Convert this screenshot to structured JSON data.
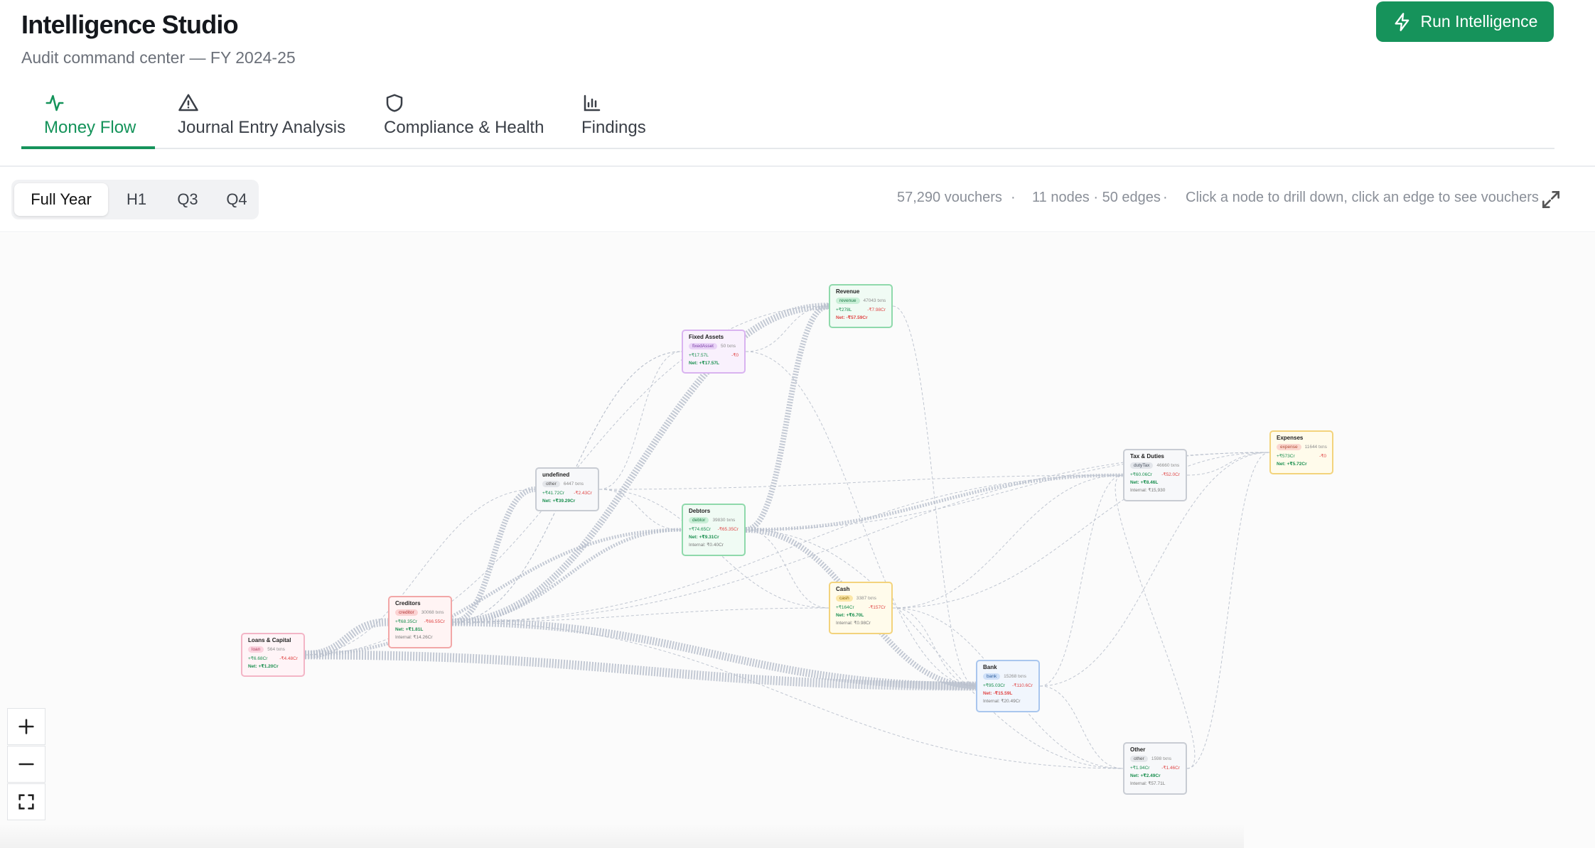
{
  "app": {
    "title": "Intelligence Studio",
    "subtitle": "Audit command center — FY 2024-25",
    "run_button": "Run Intelligence"
  },
  "tabs": [
    {
      "label": "Money Flow",
      "icon": "activity-icon",
      "active": true
    },
    {
      "label": "Journal Entry Analysis",
      "icon": "warning-triangle-icon",
      "active": false
    },
    {
      "label": "Compliance & Health",
      "icon": "shield-icon",
      "active": false
    },
    {
      "label": "Findings",
      "icon": "bar-chart-icon",
      "active": false
    }
  ],
  "periods": [
    {
      "label": "Full Year",
      "active": true
    },
    {
      "label": "H1",
      "active": false
    },
    {
      "label": "Q3",
      "active": false
    },
    {
      "label": "Q4",
      "active": false
    }
  ],
  "stats": {
    "vouchers": "57,290 vouchers",
    "sep1": "·",
    "graph": "11 nodes · 50 edges",
    "sep2": "·",
    "hint": "Click a node to drill down, click an edge to see vouchers"
  },
  "nodes": [
    {
      "id": "revenue",
      "name": "Revenue",
      "type": "revenue",
      "txns": "47043 txns",
      "inflow": "+₹278L",
      "outflow": "-₹7.98Cr",
      "net": "Net: -₹57.59Cr",
      "internal": ""
    },
    {
      "id": "fixed_assets",
      "name": "Fixed Assets",
      "type": "fixedAsset",
      "txns": "50 txns",
      "inflow": "+₹17.57L",
      "outflow": "-₹0",
      "net": "Net: +₹17.57L",
      "internal": ""
    },
    {
      "id": "undefined",
      "name": "undefined",
      "type": "other",
      "txns": "6447 txns",
      "inflow": "+₹41.72Cr",
      "outflow": "-₹2.43Cr",
      "net": "Net: +₹39.29Cr",
      "internal": ""
    },
    {
      "id": "debtors",
      "name": "Debtors",
      "type": "debtor",
      "txns": "39830 txns",
      "inflow": "+₹74.65Cr",
      "outflow": "-₹65.35Cr",
      "net": "Net: +₹9.31Cr",
      "internal": "Internal: ₹0.40Cr"
    },
    {
      "id": "cash",
      "name": "Cash",
      "type": "cash",
      "txns": "3387 txns",
      "inflow": "+₹164Cr",
      "outflow": "-₹157Cr",
      "net": "Net: +₹6.70L",
      "internal": "Internal: ₹0.98Cr"
    },
    {
      "id": "creditors",
      "name": "Creditors",
      "type": "creditor",
      "txns": "30068 txns",
      "inflow": "+₹68.35Cr",
      "outflow": "-₹66.55Cr",
      "net": "Net: +₹1.81L",
      "internal": "Internal: ₹14.26Cr"
    },
    {
      "id": "loans",
      "name": "Loans & Capital",
      "type": "loan",
      "txns": "564 txns",
      "inflow": "+₹6.68Cr",
      "outflow": "-₹4.48Cr",
      "net": "Net: +₹1.20Cr",
      "internal": ""
    },
    {
      "id": "bank",
      "name": "Bank",
      "type": "bank",
      "txns": "15268 txns",
      "inflow": "+₹95.03Cr",
      "outflow": "-₹110.6Cr",
      "net": "Net: -₹15.59L",
      "internal": "Internal: ₹20.49Cr"
    },
    {
      "id": "tax",
      "name": "Tax & Duties",
      "type": "dutyTax",
      "txns": "46660 txns",
      "inflow": "+₹60.06Cr",
      "outflow": "-₹52.0Cr",
      "net": "Net: +₹8.46L",
      "internal": "Internal: ₹15,930"
    },
    {
      "id": "expenses",
      "name": "Expenses",
      "type": "expense",
      "txns": "11644 txns",
      "inflow": "+₹573Cr",
      "outflow": "-₹0",
      "net": "Net: +₹5.72Cr",
      "internal": ""
    },
    {
      "id": "other",
      "name": "Other",
      "type": "other",
      "txns": "1598 txns",
      "inflow": "+₹1.94Cr",
      "outflow": "-₹1.46Cr",
      "net": "Net: +₹2.49Cr",
      "internal": "Internal: ₹57.71L"
    }
  ],
  "colors": {
    "accent": "#16935b",
    "edge": "#b9c0cc",
    "inflow": "#1a8f4f",
    "outflow": "#e04646"
  },
  "controls": {
    "zoom_in": "plus-icon",
    "zoom_out": "minus-icon",
    "fit": "fit-view-icon",
    "expand": "expand-icon"
  }
}
